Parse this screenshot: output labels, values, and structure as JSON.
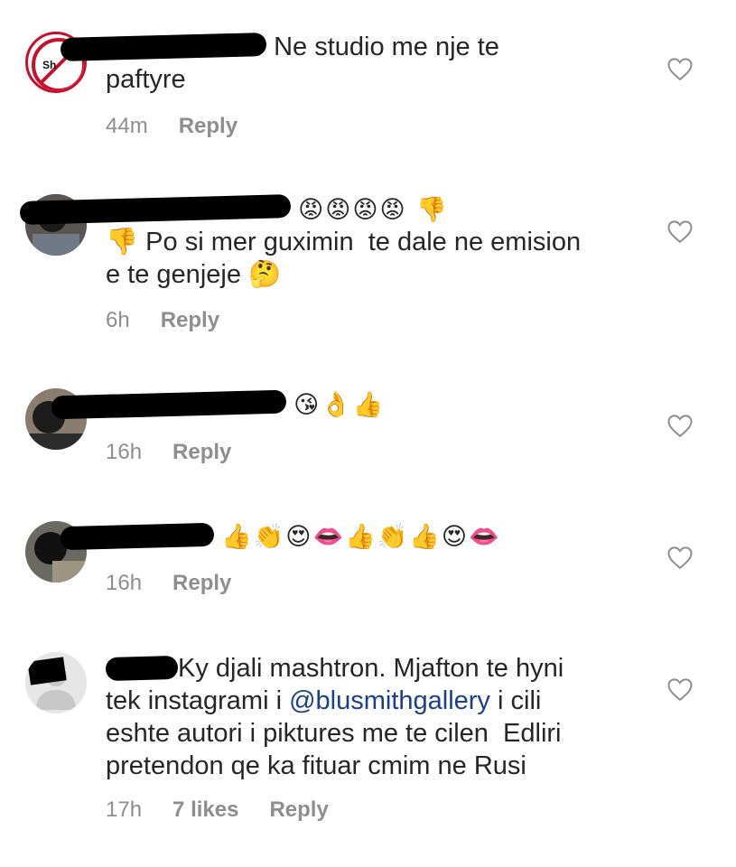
{
  "comments": [
    {
      "username_redacted": true,
      "text": "Ne studio me nje te\npaftyre",
      "time": "44m",
      "likes": "",
      "reply_label": "Reply",
      "avatar": "stop-sign-logo"
    },
    {
      "username_redacted": true,
      "emoji_prefix": "😡😡😡😡 👎",
      "text": "👎 Po si mer guximin  te dale ne emision\ne te genjeje 🤔",
      "time": "6h",
      "likes": "",
      "reply_label": "Reply",
      "avatar": "user-photo"
    },
    {
      "username_redacted": true,
      "emoji": "😘👌👍",
      "time": "16h",
      "likes": "",
      "reply_label": "Reply",
      "avatar": "user-photo"
    },
    {
      "username_redacted": true,
      "emoji": "👍👏😍👄👍👏👍😍👄",
      "time": "16h",
      "likes": "",
      "reply_label": "Reply",
      "avatar": "user-photo"
    },
    {
      "username_redacted": true,
      "text_before_mention": "Ky djali mashtron. Mjafton te hyni\ntek instagrami i ",
      "mention": "@blusmithgallery",
      "text_after_mention": " i cili\neshte autori i piktures me te cilen  Edliri\npretendon qe ka fituar cmim ne Rusi",
      "time": "17h",
      "likes": "7 likes",
      "reply_label": "Reply",
      "avatar": "default-avatar"
    }
  ],
  "colors": {
    "text": "#262626",
    "meta": "#8e8e8e",
    "mention": "#1c3f87",
    "redaction": "#000000"
  },
  "icons": {
    "like": "heart-outline-icon"
  }
}
